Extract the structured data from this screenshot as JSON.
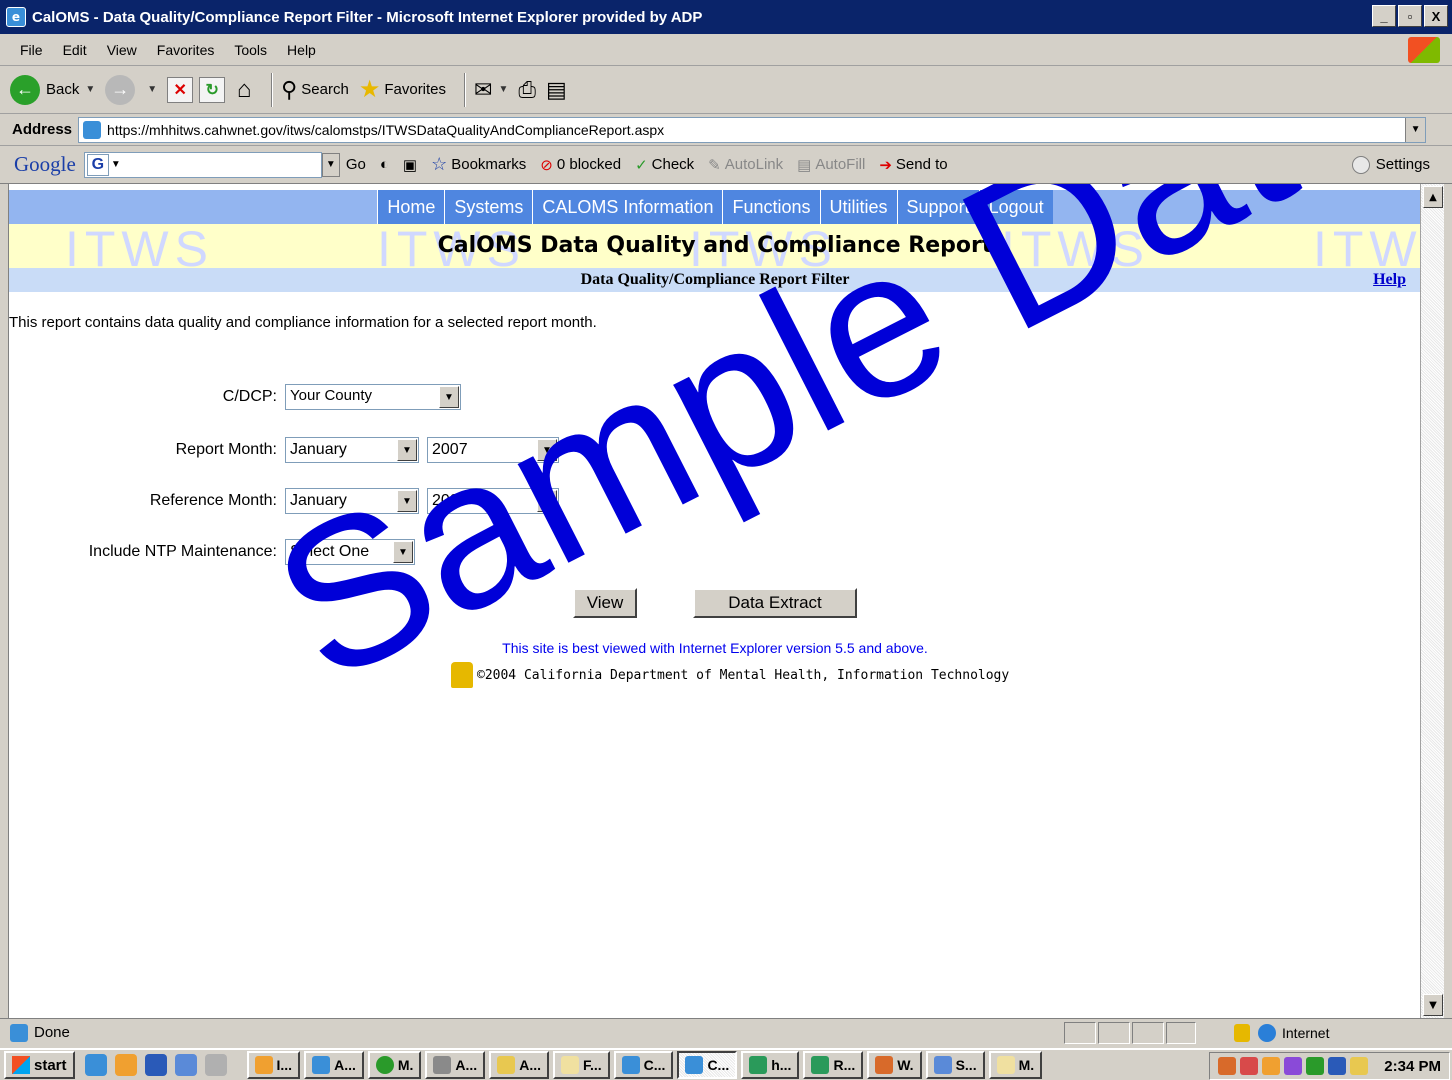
{
  "window": {
    "title": "CalOMS - Data Quality/Compliance Report Filter - Microsoft Internet Explorer provided by ADP",
    "minimize": "_",
    "maximize": "ȅ",
    "close": "X"
  },
  "menu": [
    "File",
    "Edit",
    "View",
    "Favorites",
    "Tools",
    "Help"
  ],
  "toolbar": {
    "back": "Back",
    "search": "Search",
    "favorites": "Favorites"
  },
  "address": {
    "label": "Address",
    "url": "https://mhhitws.cahwnet.gov/itws/calomstps/ITWSDataQualityAndComplianceReport.aspx"
  },
  "google_toolbar": {
    "logo": "Google",
    "go": "Go",
    "bookmarks": "Bookmarks",
    "blocked": "0 blocked",
    "check": "Check",
    "autolink": "AutoLink",
    "autofill": "AutoFill",
    "send_to": "Send to",
    "settings": "Settings"
  },
  "site_nav": [
    "Home",
    "Systems",
    "CALOMS Information",
    "Functions",
    "Utilities",
    "Support",
    "Logout"
  ],
  "page": {
    "watermark": "ITWS",
    "title": "CalOMS Data Quality and Compliance Report",
    "filter_title": "Data Quality/Compliance Report Filter",
    "help": "Help",
    "intro": "This report contains data quality and compliance information for a selected report month.",
    "form": {
      "cdcp_label": "C/DCP:",
      "cdcp_value": "Your County",
      "report_month_label": "Report Month:",
      "report_month": "January",
      "report_year": "2007",
      "reference_month_label": "Reference Month:",
      "reference_month": "January",
      "reference_year": "2007",
      "ntp_label": "Include NTP Maintenance:",
      "ntp_value": "Select One"
    },
    "view_button": "View",
    "extract_button": "Data Extract",
    "best_viewed": "This site is best viewed with Internet Explorer version 5.5 and above.",
    "copyright": "©2004 California Department of Mental Health, Information Technology",
    "overlay": "Sample Data"
  },
  "status": {
    "text": "Done",
    "zone": "Internet"
  },
  "taskbar": {
    "start": "start",
    "tasks": [
      "I...",
      "A...",
      "M.",
      "A...",
      "A...",
      "F...",
      "C...",
      "C...",
      "h...",
      "R...",
      "W.",
      "S...",
      "M."
    ],
    "clock": "2:34 PM"
  },
  "colors": {
    "title_bar": "#0a246a",
    "nav_button": "#4f86e0",
    "nav_strip": "#93b5f0",
    "title_band": "#ffffc9",
    "filter_band": "#c9dcf7",
    "link": "#0000cc",
    "overlay": "#0000d8"
  }
}
